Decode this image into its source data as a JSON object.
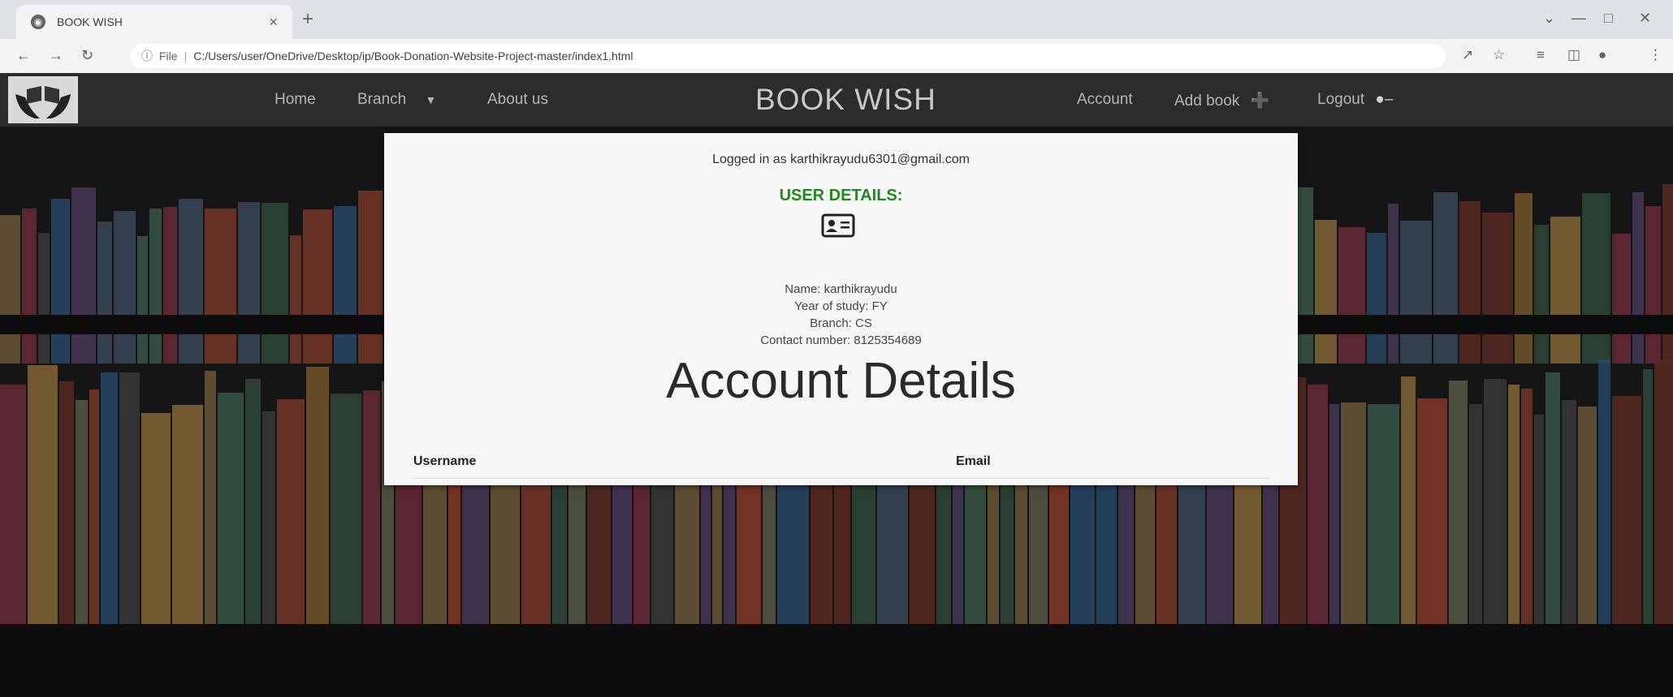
{
  "browser": {
    "tab_title": "BOOK WISH",
    "new_tab": "+",
    "file_label": "File",
    "url": "C:/Users/user/OneDrive/Desktop/ip/Book-Donation-Website-Project-master/index1.html"
  },
  "navbar": {
    "brand": "BOOK WISH",
    "left_links": [
      "Home",
      "Branch",
      "About us"
    ],
    "right_links": [
      "Account",
      "Add book",
      "Logout"
    ]
  },
  "card": {
    "logged_in": "Logged in as karthikrayudu6301@gmail.com",
    "user_details_title": "USER DETAILS:",
    "name": "Name: karthikrayudu",
    "year": "Year of study: FY",
    "branch": "Branch: CS",
    "contact": "Contact number: 8125354689",
    "account_title": "Account Details",
    "table_headers": [
      "Username",
      "Email"
    ]
  },
  "colors": {
    "user_details": "#1e8a1e",
    "navbar": "#2c2c2c",
    "card": "#f7f7f7"
  }
}
